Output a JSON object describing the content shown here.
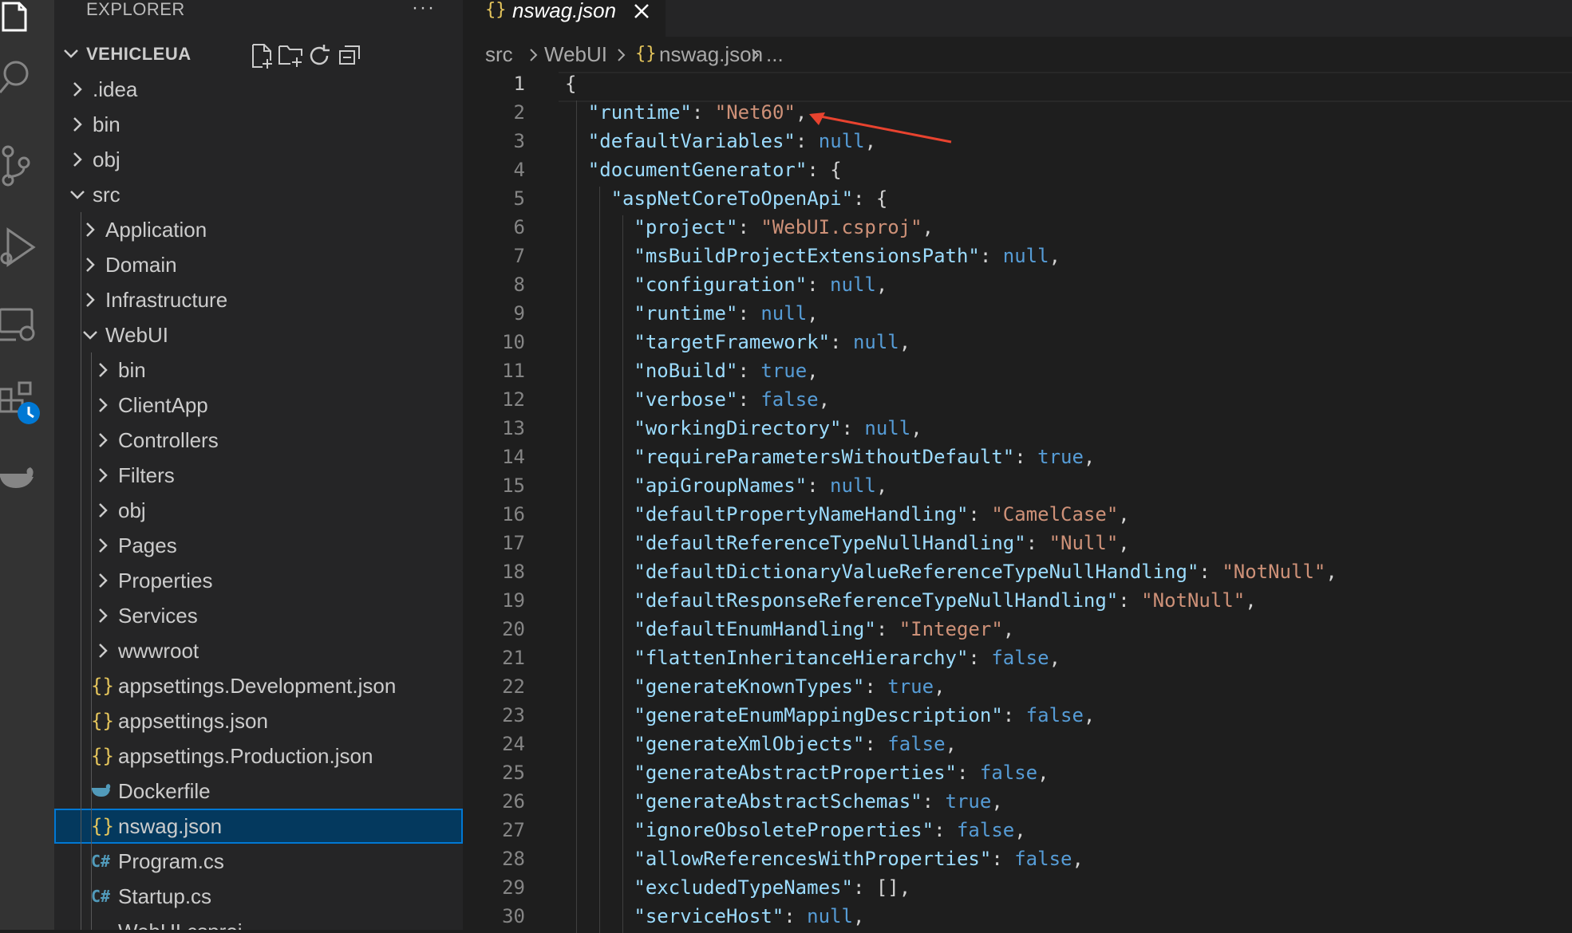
{
  "activity_bar": {
    "items": [
      {
        "name": "explorer",
        "icon": "files-icon"
      },
      {
        "name": "search",
        "icon": "search-icon"
      },
      {
        "name": "source-control",
        "icon": "source-control-icon"
      },
      {
        "name": "run-debug",
        "icon": "run-debug-icon"
      },
      {
        "name": "remote-explorer",
        "icon": "remote-explorer-icon"
      },
      {
        "name": "extensions",
        "icon": "extensions-icon"
      },
      {
        "name": "docker",
        "icon": "docker-icon"
      }
    ]
  },
  "sidebar": {
    "title": "EXPLORER",
    "more": "···",
    "workspace": "VEHICLEUA",
    "actions": [
      "new-file-icon",
      "new-folder-icon",
      "refresh-icon",
      "collapse-all-icon"
    ],
    "tree": [
      {
        "label": ".idea",
        "type": "folder",
        "expanded": false,
        "depth": 1
      },
      {
        "label": "bin",
        "type": "folder",
        "expanded": false,
        "depth": 1
      },
      {
        "label": "obj",
        "type": "folder",
        "expanded": false,
        "depth": 1
      },
      {
        "label": "src",
        "type": "folder",
        "expanded": true,
        "depth": 1
      },
      {
        "label": "Application",
        "type": "folder",
        "expanded": false,
        "depth": 2
      },
      {
        "label": "Domain",
        "type": "folder",
        "expanded": false,
        "depth": 2
      },
      {
        "label": "Infrastructure",
        "type": "folder",
        "expanded": false,
        "depth": 2
      },
      {
        "label": "WebUI",
        "type": "folder",
        "expanded": true,
        "depth": 2
      },
      {
        "label": "bin",
        "type": "folder",
        "expanded": false,
        "depth": 3
      },
      {
        "label": "ClientApp",
        "type": "folder",
        "expanded": false,
        "depth": 3
      },
      {
        "label": "Controllers",
        "type": "folder",
        "expanded": false,
        "depth": 3
      },
      {
        "label": "Filters",
        "type": "folder",
        "expanded": false,
        "depth": 3
      },
      {
        "label": "obj",
        "type": "folder",
        "expanded": false,
        "depth": 3
      },
      {
        "label": "Pages",
        "type": "folder",
        "expanded": false,
        "depth": 3
      },
      {
        "label": "Properties",
        "type": "folder",
        "expanded": false,
        "depth": 3
      },
      {
        "label": "Services",
        "type": "folder",
        "expanded": false,
        "depth": 3
      },
      {
        "label": "wwwroot",
        "type": "folder",
        "expanded": false,
        "depth": 3
      },
      {
        "label": "appsettings.Development.json",
        "type": "json",
        "icon_text": "{}",
        "depth": 3
      },
      {
        "label": "appsettings.json",
        "type": "json",
        "icon_text": "{}",
        "depth": 3
      },
      {
        "label": "appsettings.Production.json",
        "type": "json",
        "icon_text": "{}",
        "depth": 3
      },
      {
        "label": "Dockerfile",
        "type": "docker",
        "depth": 3
      },
      {
        "label": "nswag.json",
        "type": "json",
        "icon_text": "{}",
        "depth": 3,
        "selected": true
      },
      {
        "label": "Program.cs",
        "type": "csharp",
        "icon_text": "C#",
        "depth": 3
      },
      {
        "label": "Startup.cs",
        "type": "csharp",
        "icon_text": "C#",
        "depth": 3
      },
      {
        "label": "WebUI.csproj",
        "type": "xml",
        "depth": 3
      }
    ]
  },
  "tabs": [
    {
      "title": "nswag.json",
      "icon_text": "{}",
      "active": true
    }
  ],
  "breadcrumb": [
    "src",
    "WebUI",
    "nswag.json",
    "..."
  ],
  "breadcrumb_icon_text": "{}",
  "editor": {
    "current_line": 1,
    "lines": [
      {
        "n": "1",
        "indent": 0,
        "tokens": [
          [
            "p",
            "{"
          ]
        ]
      },
      {
        "n": "2",
        "indent": 1,
        "tokens": [
          [
            "k",
            "\"runtime\""
          ],
          [
            "p",
            ": "
          ],
          [
            "s",
            "\"Net60\""
          ],
          [
            "p",
            ","
          ]
        ]
      },
      {
        "n": "3",
        "indent": 1,
        "tokens": [
          [
            "k",
            "\"defaultVariables\""
          ],
          [
            "p",
            ": "
          ],
          [
            "lit",
            "null"
          ],
          [
            "p",
            ","
          ]
        ]
      },
      {
        "n": "4",
        "indent": 1,
        "tokens": [
          [
            "k",
            "\"documentGenerator\""
          ],
          [
            "p",
            ": {"
          ]
        ]
      },
      {
        "n": "5",
        "indent": 2,
        "tokens": [
          [
            "k",
            "\"aspNetCoreToOpenApi\""
          ],
          [
            "p",
            ": {"
          ]
        ]
      },
      {
        "n": "6",
        "indent": 3,
        "tokens": [
          [
            "k",
            "\"project\""
          ],
          [
            "p",
            ": "
          ],
          [
            "s",
            "\"WebUI.csproj\""
          ],
          [
            "p",
            ","
          ]
        ]
      },
      {
        "n": "7",
        "indent": 3,
        "tokens": [
          [
            "k",
            "\"msBuildProjectExtensionsPath\""
          ],
          [
            "p",
            ": "
          ],
          [
            "lit",
            "null"
          ],
          [
            "p",
            ","
          ]
        ]
      },
      {
        "n": "8",
        "indent": 3,
        "tokens": [
          [
            "k",
            "\"configuration\""
          ],
          [
            "p",
            ": "
          ],
          [
            "lit",
            "null"
          ],
          [
            "p",
            ","
          ]
        ]
      },
      {
        "n": "9",
        "indent": 3,
        "tokens": [
          [
            "k",
            "\"runtime\""
          ],
          [
            "p",
            ": "
          ],
          [
            "lit",
            "null"
          ],
          [
            "p",
            ","
          ]
        ]
      },
      {
        "n": "10",
        "indent": 3,
        "tokens": [
          [
            "k",
            "\"targetFramework\""
          ],
          [
            "p",
            ": "
          ],
          [
            "lit",
            "null"
          ],
          [
            "p",
            ","
          ]
        ]
      },
      {
        "n": "11",
        "indent": 3,
        "tokens": [
          [
            "k",
            "\"noBuild\""
          ],
          [
            "p",
            ": "
          ],
          [
            "lit",
            "true"
          ],
          [
            "p",
            ","
          ]
        ]
      },
      {
        "n": "12",
        "indent": 3,
        "tokens": [
          [
            "k",
            "\"verbose\""
          ],
          [
            "p",
            ": "
          ],
          [
            "lit",
            "false"
          ],
          [
            "p",
            ","
          ]
        ]
      },
      {
        "n": "13",
        "indent": 3,
        "tokens": [
          [
            "k",
            "\"workingDirectory\""
          ],
          [
            "p",
            ": "
          ],
          [
            "lit",
            "null"
          ],
          [
            "p",
            ","
          ]
        ]
      },
      {
        "n": "14",
        "indent": 3,
        "tokens": [
          [
            "k",
            "\"requireParametersWithoutDefault\""
          ],
          [
            "p",
            ": "
          ],
          [
            "lit",
            "true"
          ],
          [
            "p",
            ","
          ]
        ]
      },
      {
        "n": "15",
        "indent": 3,
        "tokens": [
          [
            "k",
            "\"apiGroupNames\""
          ],
          [
            "p",
            ": "
          ],
          [
            "lit",
            "null"
          ],
          [
            "p",
            ","
          ]
        ]
      },
      {
        "n": "16",
        "indent": 3,
        "tokens": [
          [
            "k",
            "\"defaultPropertyNameHandling\""
          ],
          [
            "p",
            ": "
          ],
          [
            "s",
            "\"CamelCase\""
          ],
          [
            "p",
            ","
          ]
        ]
      },
      {
        "n": "17",
        "indent": 3,
        "tokens": [
          [
            "k",
            "\"defaultReferenceTypeNullHandling\""
          ],
          [
            "p",
            ": "
          ],
          [
            "s",
            "\"Null\""
          ],
          [
            "p",
            ","
          ]
        ]
      },
      {
        "n": "18",
        "indent": 3,
        "tokens": [
          [
            "k",
            "\"defaultDictionaryValueReferenceTypeNullHandling\""
          ],
          [
            "p",
            ": "
          ],
          [
            "s",
            "\"NotNull\""
          ],
          [
            "p",
            ","
          ]
        ]
      },
      {
        "n": "19",
        "indent": 3,
        "tokens": [
          [
            "k",
            "\"defaultResponseReferenceTypeNullHandling\""
          ],
          [
            "p",
            ": "
          ],
          [
            "s",
            "\"NotNull\""
          ],
          [
            "p",
            ","
          ]
        ]
      },
      {
        "n": "20",
        "indent": 3,
        "tokens": [
          [
            "k",
            "\"defaultEnumHandling\""
          ],
          [
            "p",
            ": "
          ],
          [
            "s",
            "\"Integer\""
          ],
          [
            "p",
            ","
          ]
        ]
      },
      {
        "n": "21",
        "indent": 3,
        "tokens": [
          [
            "k",
            "\"flattenInheritanceHierarchy\""
          ],
          [
            "p",
            ": "
          ],
          [
            "lit",
            "false"
          ],
          [
            "p",
            ","
          ]
        ]
      },
      {
        "n": "22",
        "indent": 3,
        "tokens": [
          [
            "k",
            "\"generateKnownTypes\""
          ],
          [
            "p",
            ": "
          ],
          [
            "lit",
            "true"
          ],
          [
            "p",
            ","
          ]
        ]
      },
      {
        "n": "23",
        "indent": 3,
        "tokens": [
          [
            "k",
            "\"generateEnumMappingDescription\""
          ],
          [
            "p",
            ": "
          ],
          [
            "lit",
            "false"
          ],
          [
            "p",
            ","
          ]
        ]
      },
      {
        "n": "24",
        "indent": 3,
        "tokens": [
          [
            "k",
            "\"generateXmlObjects\""
          ],
          [
            "p",
            ": "
          ],
          [
            "lit",
            "false"
          ],
          [
            "p",
            ","
          ]
        ]
      },
      {
        "n": "25",
        "indent": 3,
        "tokens": [
          [
            "k",
            "\"generateAbstractProperties\""
          ],
          [
            "p",
            ": "
          ],
          [
            "lit",
            "false"
          ],
          [
            "p",
            ","
          ]
        ]
      },
      {
        "n": "26",
        "indent": 3,
        "tokens": [
          [
            "k",
            "\"generateAbstractSchemas\""
          ],
          [
            "p",
            ": "
          ],
          [
            "lit",
            "true"
          ],
          [
            "p",
            ","
          ]
        ]
      },
      {
        "n": "27",
        "indent": 3,
        "tokens": [
          [
            "k",
            "\"ignoreObsoleteProperties\""
          ],
          [
            "p",
            ": "
          ],
          [
            "lit",
            "false"
          ],
          [
            "p",
            ","
          ]
        ]
      },
      {
        "n": "28",
        "indent": 3,
        "tokens": [
          [
            "k",
            "\"allowReferencesWithProperties\""
          ],
          [
            "p",
            ": "
          ],
          [
            "lit",
            "false"
          ],
          [
            "p",
            ","
          ]
        ]
      },
      {
        "n": "29",
        "indent": 3,
        "tokens": [
          [
            "k",
            "\"excludedTypeNames\""
          ],
          [
            "p",
            ": []"
          ],
          [
            "p",
            ","
          ]
        ]
      },
      {
        "n": "30",
        "indent": 3,
        "tokens": [
          [
            "k",
            "\"serviceHost\""
          ],
          [
            "p",
            ": "
          ],
          [
            "lit",
            "null"
          ],
          [
            "p",
            ","
          ]
        ]
      }
    ]
  },
  "annotation": {
    "type": "arrow",
    "color": "#e8432f",
    "points_to": "line 2 value"
  },
  "colors": {
    "activity_bar": "#333333",
    "sidebar": "#252526",
    "editor": "#1e1e1e",
    "selection": "#04395e",
    "focus_border": "#0078d4",
    "json_key": "#9cdcfe",
    "json_string": "#ce9178",
    "json_literal": "#569cd6",
    "json_icon": "#e6c65c",
    "csharp_icon": "#519aba"
  }
}
